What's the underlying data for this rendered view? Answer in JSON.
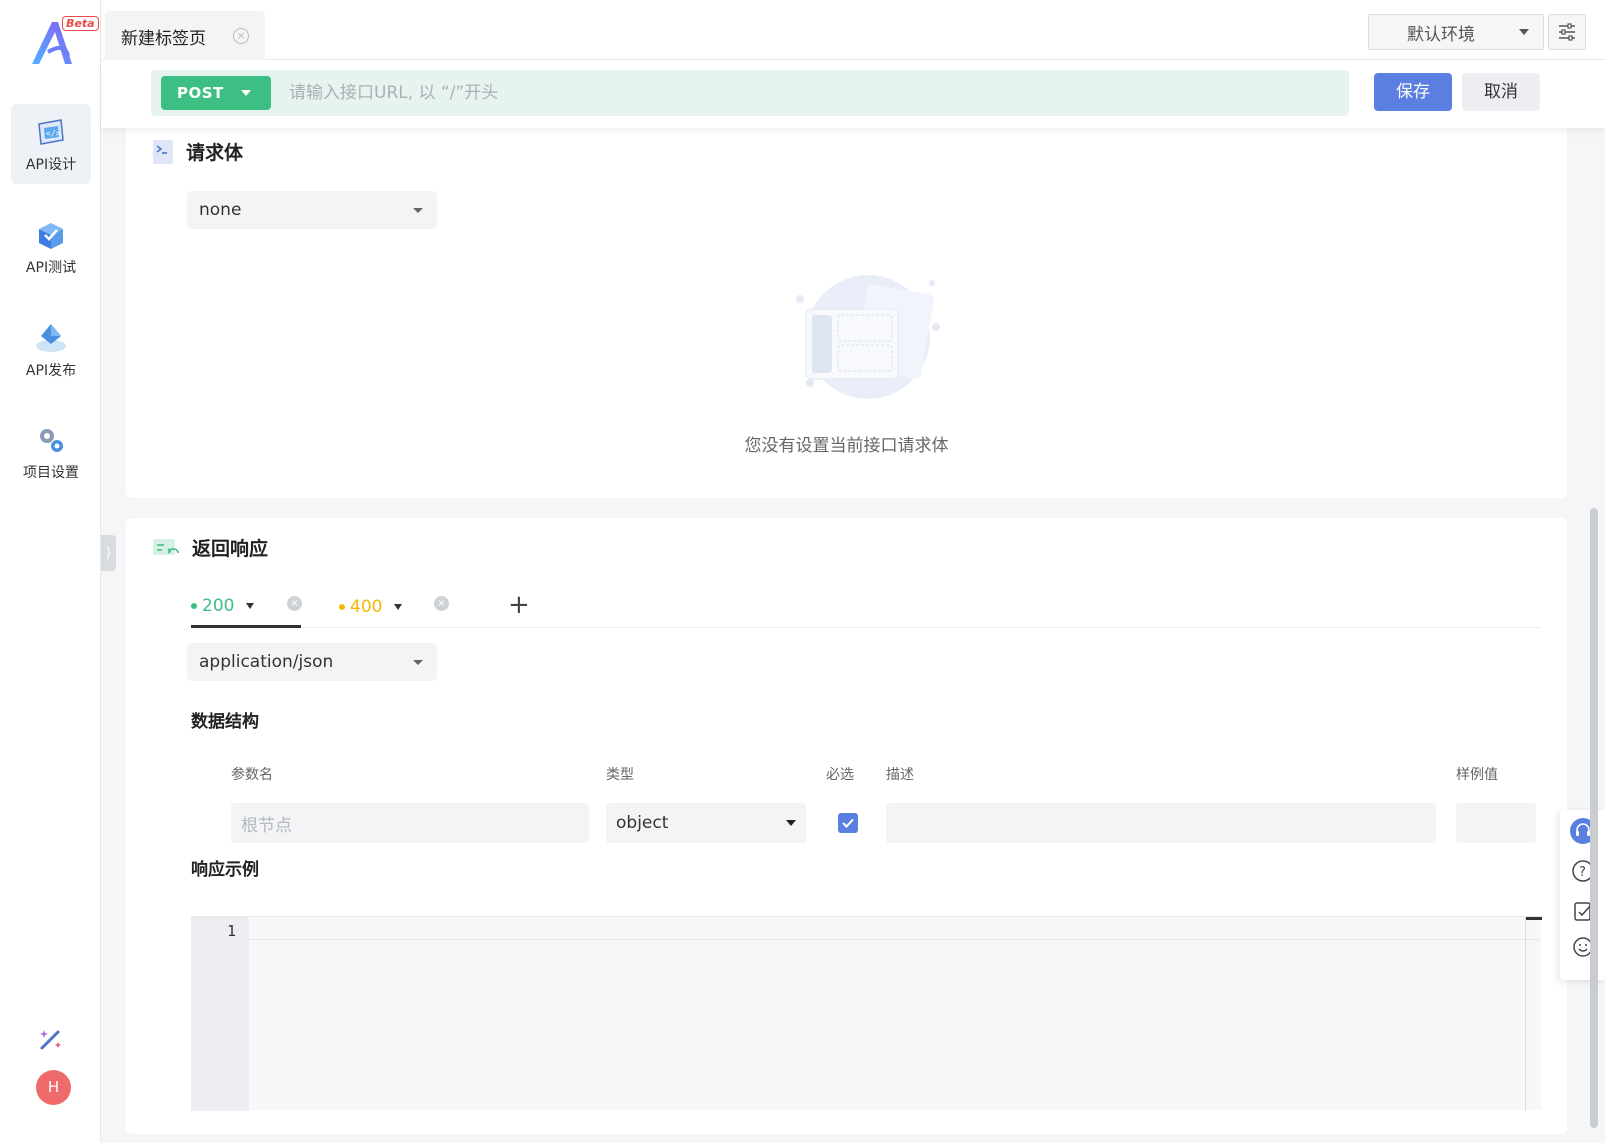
{
  "sidebar": {
    "beta_label": "Beta",
    "items": [
      {
        "label": "API设计",
        "icon": "api-design-icon",
        "active": true
      },
      {
        "label": "API测试",
        "icon": "api-test-icon",
        "active": false
      },
      {
        "label": "API发布",
        "icon": "api-publish-icon",
        "active": false
      },
      {
        "label": "项目设置",
        "icon": "project-settings-icon",
        "active": false
      }
    ],
    "avatar_initial": "H"
  },
  "tabs": [
    {
      "label": "新建标签页"
    }
  ],
  "env": {
    "selected": "默认环境"
  },
  "urlbar": {
    "method": "POST",
    "placeholder": "请输入接口URL, 以 “/”开头",
    "save_label": "保存",
    "cancel_label": "取消"
  },
  "request_body": {
    "title": "请求体",
    "type_selected": "none",
    "empty_text": "您没有设置当前接口请求体"
  },
  "response": {
    "title": "返回响应",
    "status_tabs": [
      {
        "code": "200",
        "color": "#3dbf84",
        "active": true
      },
      {
        "code": "400",
        "color": "#f5b800",
        "active": false
      }
    ],
    "content_type": "application/json",
    "schema_title": "数据结构",
    "columns": {
      "name": "参数名",
      "type": "类型",
      "required": "必选",
      "desc": "描述",
      "sample": "样例值"
    },
    "root_placeholder": "根节点",
    "root_type": "object",
    "root_required": true,
    "example_title": "响应示例",
    "editor_lines": [
      "1"
    ]
  },
  "colors": {
    "primary": "#5b7fe0",
    "post_green": "#3dbf84",
    "warning": "#f5b800",
    "avatar": "#ef6b6b"
  }
}
